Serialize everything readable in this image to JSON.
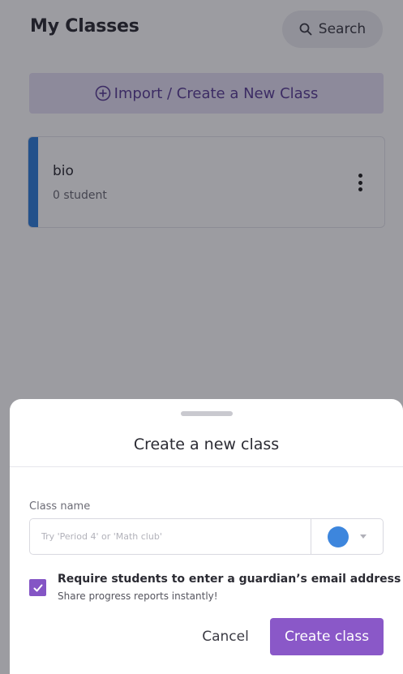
{
  "header": {
    "title": "My Classes",
    "search_label": "Search"
  },
  "import_button": {
    "label": "Import / Create a New Class",
    "icon": "plus-circle-icon"
  },
  "classes": [
    {
      "name": "bio",
      "count": "0 student",
      "accent_color": "#2f7fd9",
      "menu_icon": "kebab-menu-icon"
    }
  ],
  "sheet": {
    "title": "Create a new class",
    "field_label": "Class name",
    "field_placeholder": "Try 'Period 4' or 'Math club'",
    "field_value": "",
    "selected_color": "#3d86dd",
    "checkbox": {
      "checked": true,
      "title": "Require students to enter a guardian’s email address",
      "subtitle": "Share progress reports instantly!"
    },
    "cancel_label": "Cancel",
    "create_label": "Create class"
  },
  "colors": {
    "brand_purple": "#8a58c8",
    "import_bg": "#e6e0f4",
    "import_text": "#5b3f96"
  }
}
